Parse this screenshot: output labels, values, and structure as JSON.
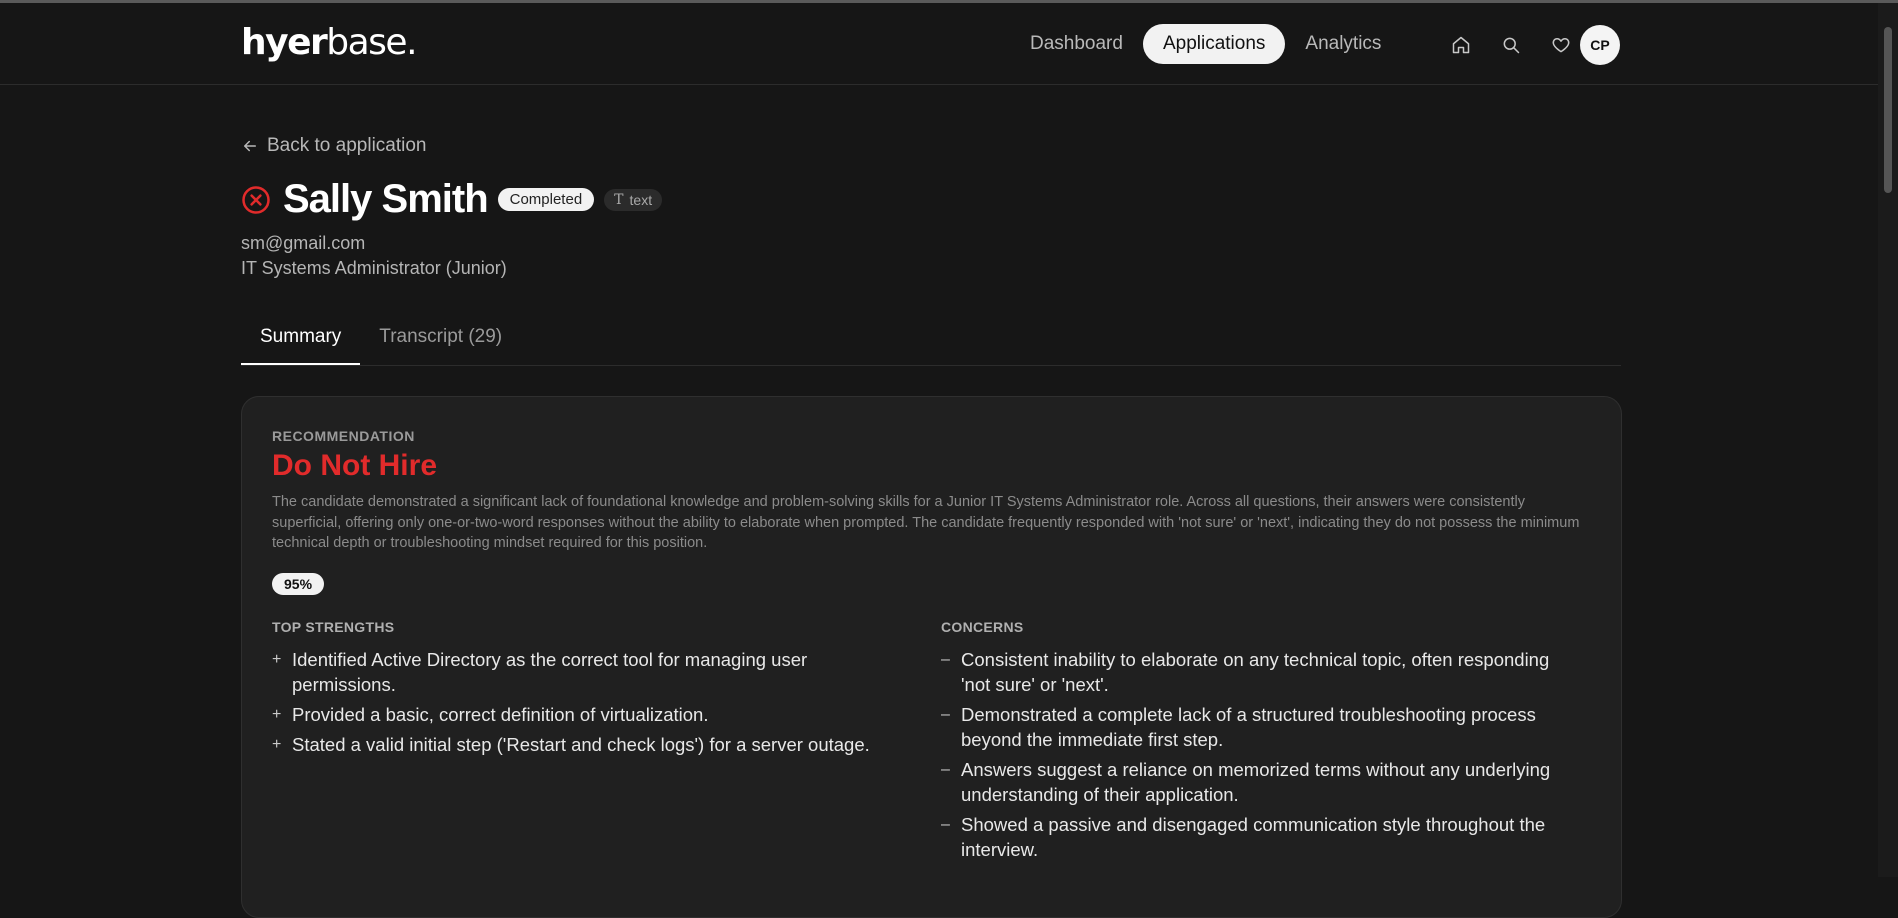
{
  "app": {
    "logo_bold": "hyer",
    "logo_light": "base."
  },
  "nav": {
    "items": [
      {
        "label": "Dashboard",
        "active": false
      },
      {
        "label": "Applications",
        "active": true
      },
      {
        "label": "Analytics",
        "active": false
      }
    ],
    "icons": [
      "home-icon",
      "search-icon",
      "heart-icon"
    ],
    "avatar_initials": "CP"
  },
  "page": {
    "back_label": "Back to application",
    "candidate_name": "Sally Smith",
    "status": "Completed",
    "type_badge": "text",
    "email": "sm@gmail.com",
    "role": "IT Systems Administrator (Junior)",
    "status_icon": "x-circle-icon",
    "status_icon_color": "#e12b2b"
  },
  "tabs": [
    {
      "label": "Summary",
      "active": true
    },
    {
      "label": "Transcript (29)",
      "active": false
    }
  ],
  "recommendation": {
    "label": "RECOMMENDATION",
    "value": "Do Not Hire",
    "value_color": "#e12b2b",
    "text": "The candidate demonstrated a significant lack of foundational knowledge and problem-solving skills for a Junior IT Systems Administrator role. Across all questions, their answers were consistently superficial, offering only one-or-two-word responses without the ability to elaborate when prompted. The candidate frequently responded with 'not sure' or 'next', indicating they do not possess the minimum technical depth or troubleshooting mindset required for this position.",
    "confidence": "95%"
  },
  "strengths": {
    "title": "TOP STRENGTHS",
    "items": [
      "Identified Active Directory as the correct tool for managing user permissions.",
      "Provided a basic, correct definition of virtualization.",
      "Stated a valid initial step ('Restart and check logs') for a server outage."
    ]
  },
  "concerns": {
    "title": "CONCERNS",
    "items": [
      "Consistent inability to elaborate on any technical topic, often responding 'not sure' or 'next'.",
      "Demonstrated a complete lack of a structured troubleshooting process beyond the immediate first step.",
      "Answers suggest a reliance on memorized terms without any underlying understanding of their application.",
      "Showed a passive and disengaged communication style throughout the interview."
    ]
  }
}
